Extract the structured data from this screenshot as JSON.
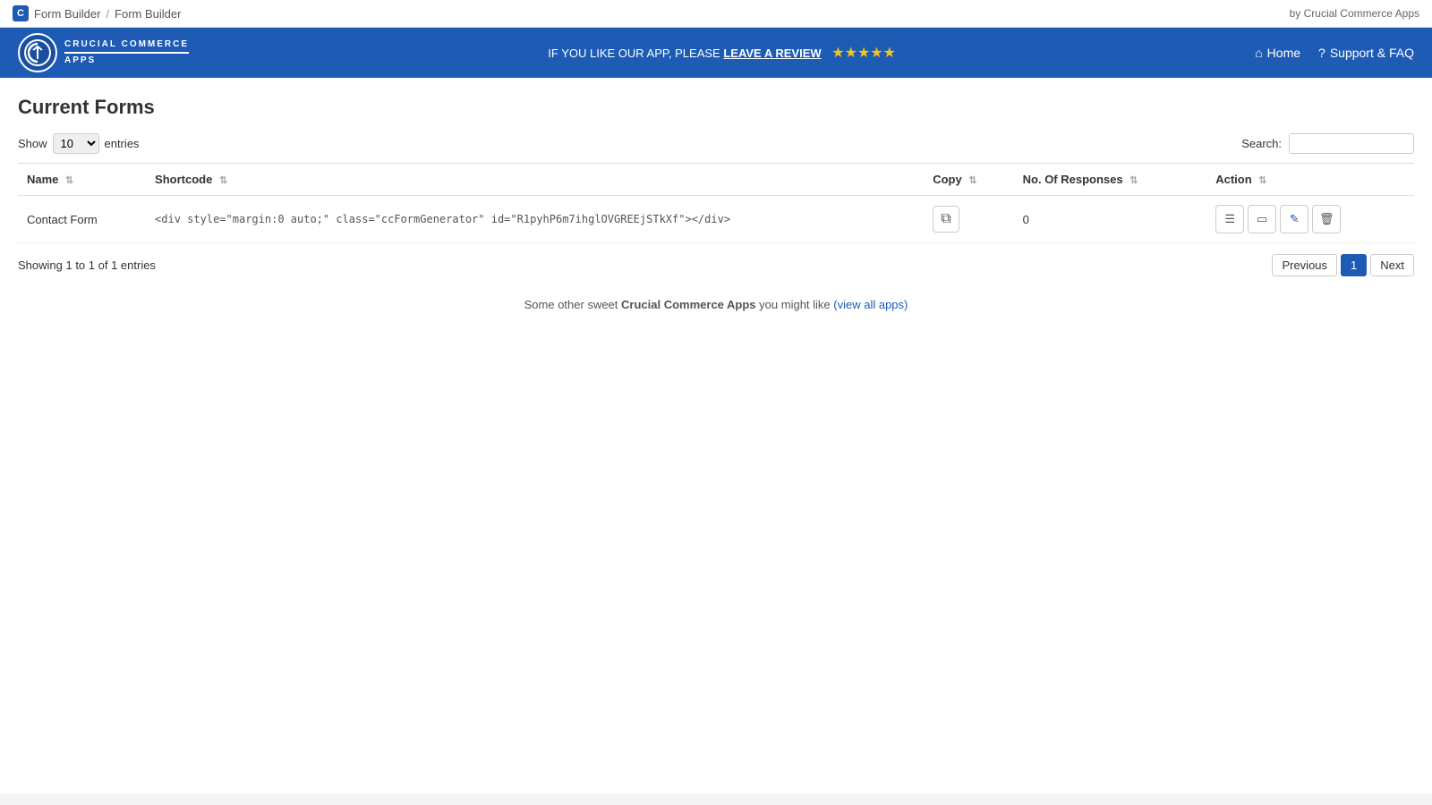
{
  "topbar": {
    "logo_letter": "C",
    "breadcrumb1": "Form Builder",
    "separator": "/",
    "breadcrumb2": "Form Builder",
    "by_label": "by Crucial Commerce Apps"
  },
  "navbar": {
    "logo_letter": "C",
    "logo_line1": "CRUCIAL COMMERCE",
    "logo_line2": "APPS",
    "promo_text": "IF YOU LIKE OUR APP, PLEASE",
    "promo_link": "LEAVE A REVIEW",
    "stars": "★★★★★",
    "home_label": "Home",
    "support_label": "Support & FAQ"
  },
  "page": {
    "title": "Current Forms",
    "show_label": "Show",
    "entries_label": "entries",
    "show_value": "10",
    "search_label": "Search:",
    "search_placeholder": ""
  },
  "table": {
    "columns": [
      {
        "id": "name",
        "label": "Name"
      },
      {
        "id": "shortcode",
        "label": "Shortcode"
      },
      {
        "id": "copy",
        "label": "Copy"
      },
      {
        "id": "responses",
        "label": "No. Of Responses"
      },
      {
        "id": "action",
        "label": "Action"
      }
    ],
    "rows": [
      {
        "name": "Contact Form",
        "shortcode": "<div style=\"margin:0 auto;\" class=\"ccFormGenerator\" id=\"R1pyhP6m7ihglOVGREEjSTkXf\"></div>",
        "copy_title": "Copy shortcode",
        "responses": "0",
        "actions": [
          "view-responses",
          "preview",
          "edit",
          "delete"
        ]
      }
    ]
  },
  "pagination": {
    "showing_text": "Showing 1 to 1 of 1 entries",
    "prev_label": "Previous",
    "page_num": "1",
    "next_label": "Next"
  },
  "footer": {
    "text_before": "Some other sweet",
    "brand": "Crucial Commerce Apps",
    "text_after": "you might like",
    "link_text": "(view all apps)",
    "link_href": "#"
  }
}
